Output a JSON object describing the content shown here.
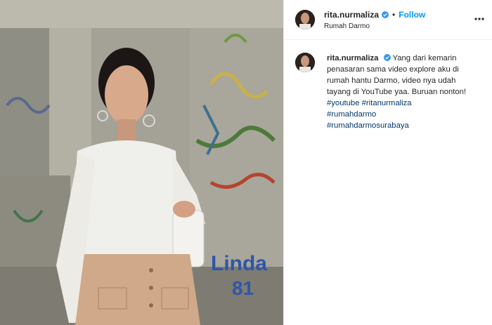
{
  "post": {
    "username": "rita.nurmaliza",
    "location": "Rumah Darmo",
    "follow_label": "Follow",
    "separator": "•",
    "caption": {
      "username": "rita.nurmaliza",
      "text": "Yang dari kemarin penasaran sama video explore aku di rumah hantu Darmo, video nya udah tayang di YouTube yaa. Buruan nonton!",
      "hashtags": [
        "#youtube #ritanurmaliza",
        "#rumahdarmo",
        "#rumahdarmosurabaya"
      ]
    },
    "photo_graffiti_text": [
      "Linda",
      "81"
    ]
  },
  "colors": {
    "link_blue": "#0095f6",
    "hashtag_blue": "#00376b",
    "verified_badge": "#3897f0"
  },
  "icons": {
    "verified": "verified-badge-icon",
    "more": "more-options-icon"
  }
}
